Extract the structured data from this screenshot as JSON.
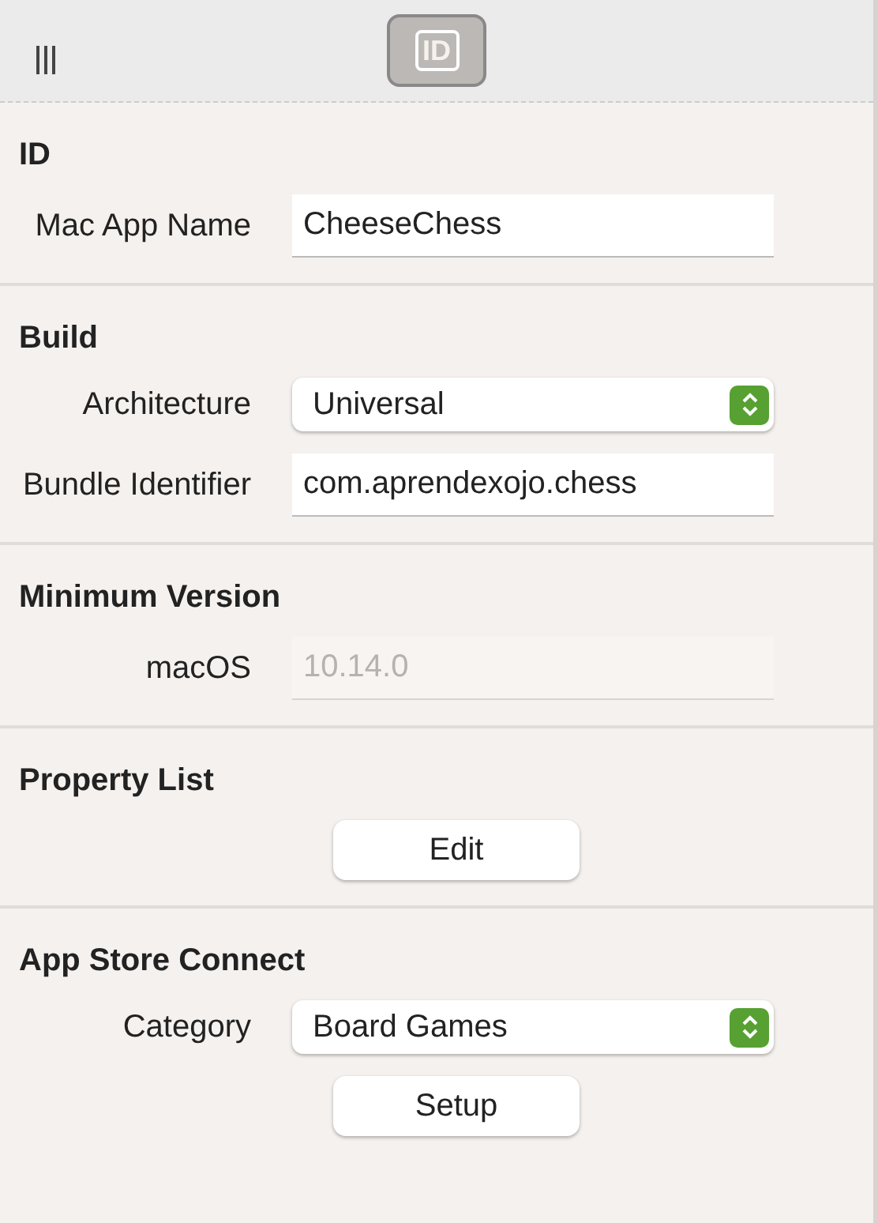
{
  "toolbar": {
    "tab": {
      "label": "ID",
      "selected": true
    }
  },
  "sections": [
    {
      "title": "ID",
      "rows": [
        {
          "kind": "field",
          "label": "Mac App Name",
          "value": "CheeseChess",
          "disabled": false
        }
      ]
    },
    {
      "title": "Build",
      "rows": [
        {
          "kind": "select",
          "label": "Architecture",
          "value": "Universal"
        },
        {
          "kind": "field",
          "label": "Bundle Identifier",
          "value": "com.aprendexojo.chess",
          "disabled": false
        }
      ]
    },
    {
      "title": "Minimum Version",
      "rows": [
        {
          "kind": "field",
          "label": "macOS",
          "placeholder": "10.14.0",
          "disabled": true
        }
      ]
    },
    {
      "title": "Property List",
      "rows": [
        {
          "kind": "button",
          "label": "Edit"
        }
      ]
    },
    {
      "title": "App Store Connect",
      "rows": [
        {
          "kind": "select",
          "label": "Category",
          "value": "Board Games"
        },
        {
          "kind": "button",
          "label": "Setup"
        }
      ]
    }
  ]
}
